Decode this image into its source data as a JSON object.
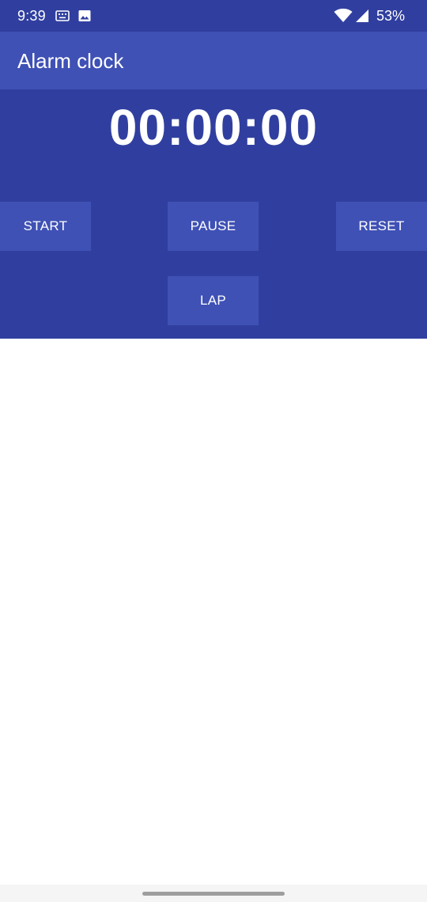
{
  "status_bar": {
    "time": "9:39",
    "icons_left": [
      "keyboard-icon",
      "image-icon"
    ],
    "icons_right": [
      "wifi-icon",
      "signal-icon"
    ],
    "battery": "53%"
  },
  "app_bar": {
    "title": "Alarm clock"
  },
  "stopwatch": {
    "display": "00:00:00",
    "buttons": {
      "start": "START",
      "pause": "PAUSE",
      "reset": "RESET",
      "lap": "LAP"
    }
  },
  "colors": {
    "primary": "#3F51B5",
    "primary_dark": "#303F9F",
    "text_on_primary": "#FFFFFF",
    "background": "#FFFFFF"
  }
}
